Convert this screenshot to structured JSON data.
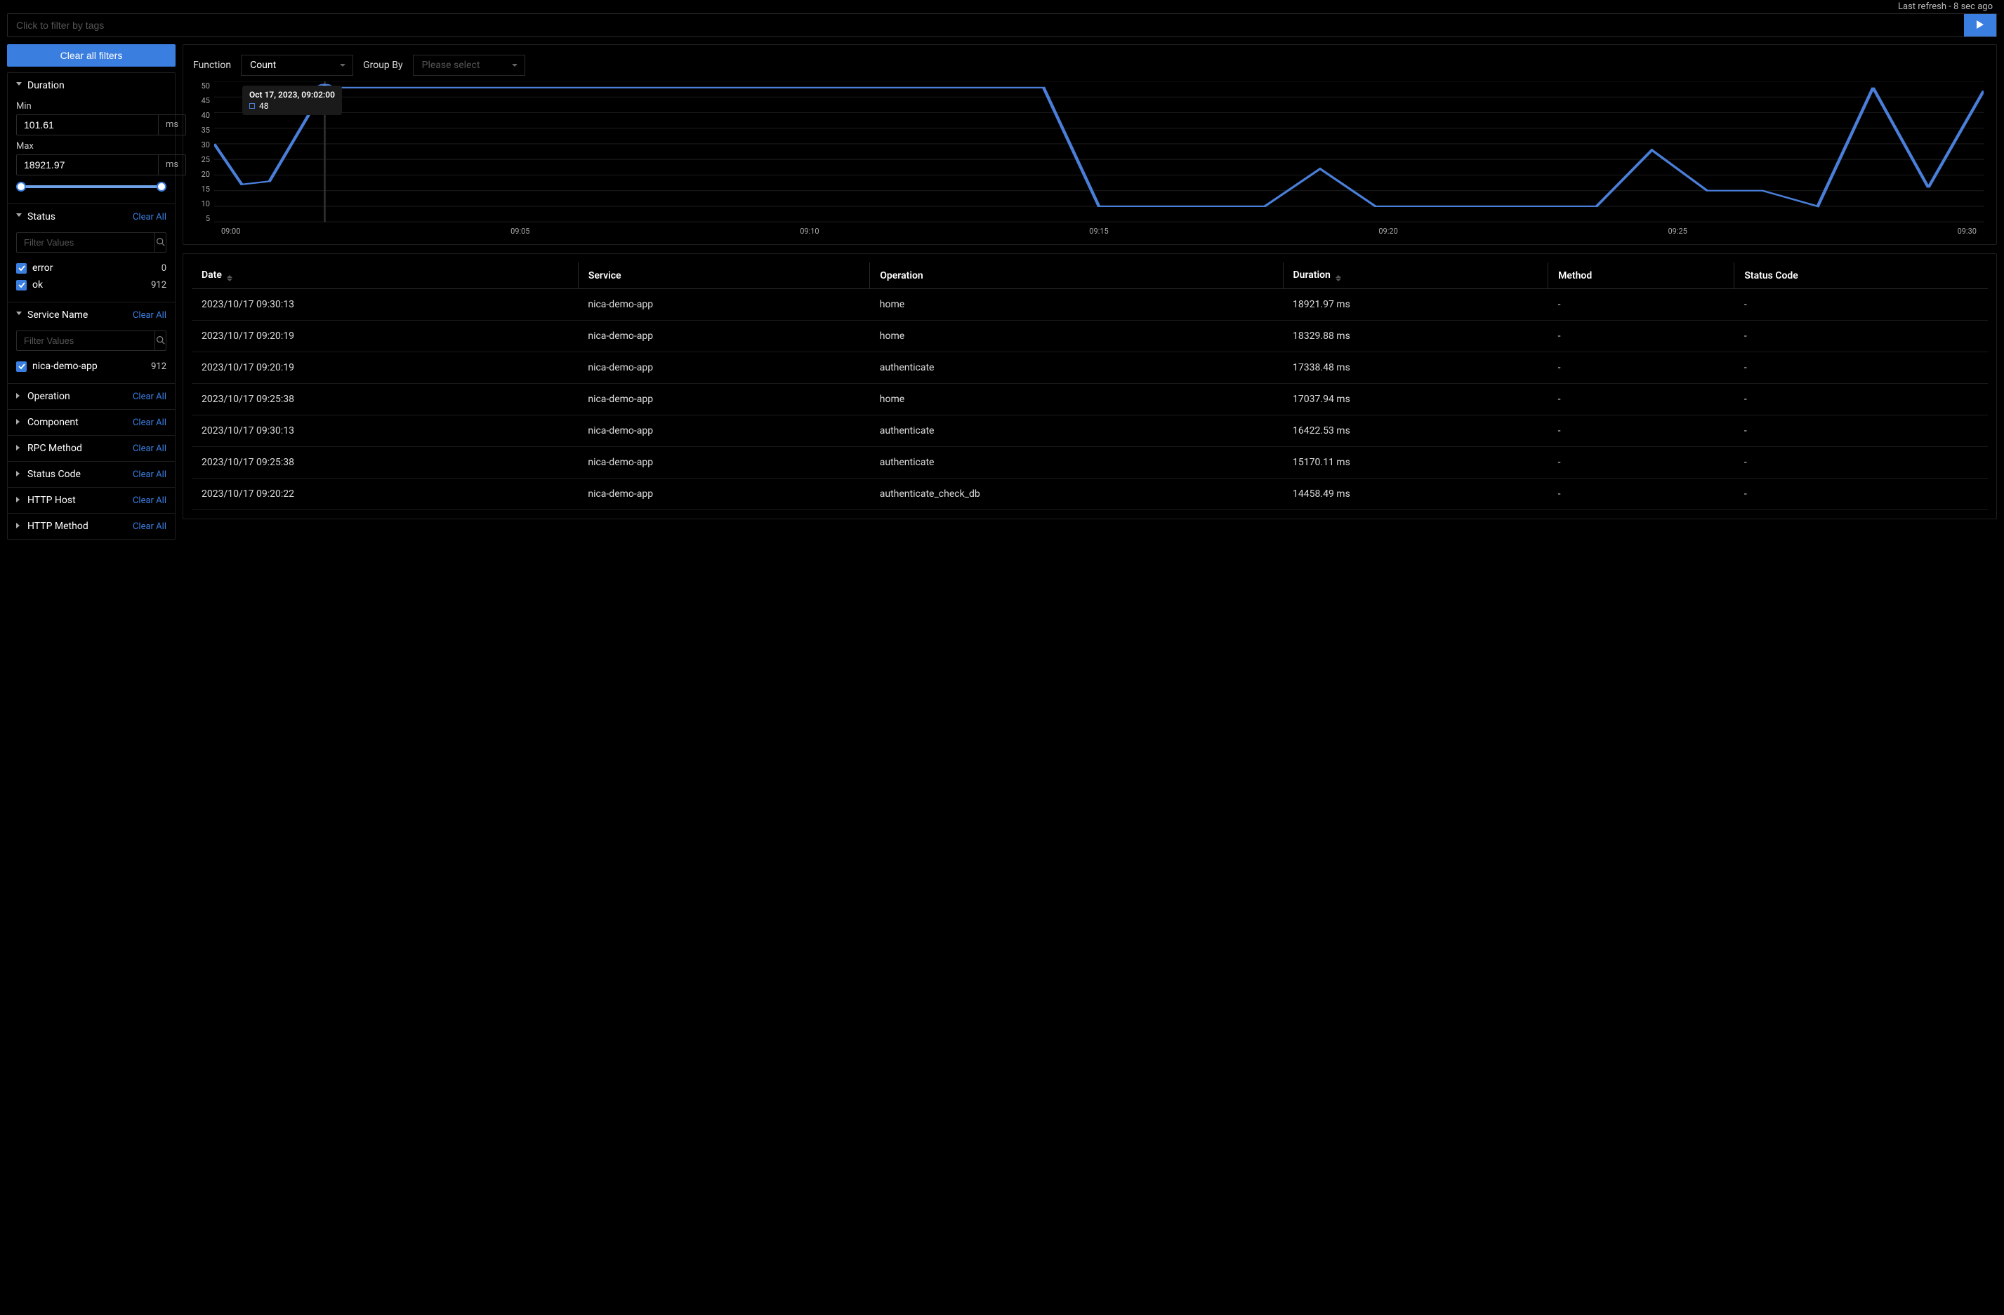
{
  "header": {
    "refresh_text": "Last refresh - 8 sec ago",
    "search_placeholder": "Click to filter by tags"
  },
  "sidebar": {
    "clear_all_filters": "Clear all filters",
    "clear_all_label": "Clear All",
    "duration": {
      "title": "Duration",
      "min_label": "Min",
      "min_value": "101.61",
      "max_label": "Max",
      "max_value": "18921.97",
      "unit": "ms"
    },
    "status": {
      "title": "Status",
      "filter_placeholder": "Filter Values",
      "items": [
        {
          "label": "error",
          "count": "0"
        },
        {
          "label": "ok",
          "count": "912"
        }
      ]
    },
    "service_name": {
      "title": "Service Name",
      "filter_placeholder": "Filter Values",
      "items": [
        {
          "label": "nica-demo-app",
          "count": "912"
        }
      ]
    },
    "collapsed": [
      {
        "title": "Operation"
      },
      {
        "title": "Component"
      },
      {
        "title": "RPC Method"
      },
      {
        "title": "Status Code"
      },
      {
        "title": "HTTP Host"
      },
      {
        "title": "HTTP Method"
      }
    ]
  },
  "chart": {
    "function_label": "Function",
    "function_value": "Count",
    "group_by_label": "Group By",
    "group_by_placeholder": "Please select",
    "tooltip_title": "Oct 17, 2023, 09:02:00",
    "tooltip_value": "48"
  },
  "chart_data": {
    "type": "line",
    "title": "",
    "xlabel": "",
    "ylabel": "",
    "ylim": [
      5,
      50
    ],
    "y_ticks": [
      5,
      10,
      15,
      20,
      25,
      30,
      35,
      40,
      45,
      50
    ],
    "x_ticks": [
      "09:00",
      "09:05",
      "09:10",
      "09:15",
      "09:20",
      "09:25",
      "09:30"
    ],
    "series": [
      {
        "name": "count",
        "x": [
          0,
          1,
          2,
          4,
          6,
          8,
          10,
          12,
          14,
          16,
          18,
          20,
          22,
          24,
          26,
          28,
          30,
          32,
          34,
          36,
          38,
          40,
          42,
          44,
          46,
          48,
          50,
          52,
          54,
          56,
          58,
          60,
          62,
          64
        ],
        "y": [
          30,
          17,
          18,
          48,
          48,
          48,
          48,
          48,
          48,
          48,
          48,
          48,
          48,
          48,
          48,
          48,
          48,
          10,
          10,
          10,
          10,
          22,
          10,
          10,
          10,
          10,
          10,
          28,
          15,
          15,
          10,
          48,
          16,
          47
        ]
      }
    ]
  },
  "table": {
    "columns": [
      "Date",
      "Service",
      "Operation",
      "Duration",
      "Method",
      "Status Code"
    ],
    "rows": [
      {
        "date": "2023/10/17 09:30:13",
        "service": "nica-demo-app",
        "operation": "home",
        "duration": "18921.97 ms",
        "method": "-",
        "status": "-"
      },
      {
        "date": "2023/10/17 09:20:19",
        "service": "nica-demo-app",
        "operation": "home",
        "duration": "18329.88 ms",
        "method": "-",
        "status": "-"
      },
      {
        "date": "2023/10/17 09:20:19",
        "service": "nica-demo-app",
        "operation": "authenticate",
        "duration": "17338.48 ms",
        "method": "-",
        "status": "-"
      },
      {
        "date": "2023/10/17 09:25:38",
        "service": "nica-demo-app",
        "operation": "home",
        "duration": "17037.94 ms",
        "method": "-",
        "status": "-"
      },
      {
        "date": "2023/10/17 09:30:13",
        "service": "nica-demo-app",
        "operation": "authenticate",
        "duration": "16422.53 ms",
        "method": "-",
        "status": "-"
      },
      {
        "date": "2023/10/17 09:25:38",
        "service": "nica-demo-app",
        "operation": "authenticate",
        "duration": "15170.11 ms",
        "method": "-",
        "status": "-"
      },
      {
        "date": "2023/10/17 09:20:22",
        "service": "nica-demo-app",
        "operation": "authenticate_check_db",
        "duration": "14458.49 ms",
        "method": "-",
        "status": "-"
      }
    ]
  }
}
